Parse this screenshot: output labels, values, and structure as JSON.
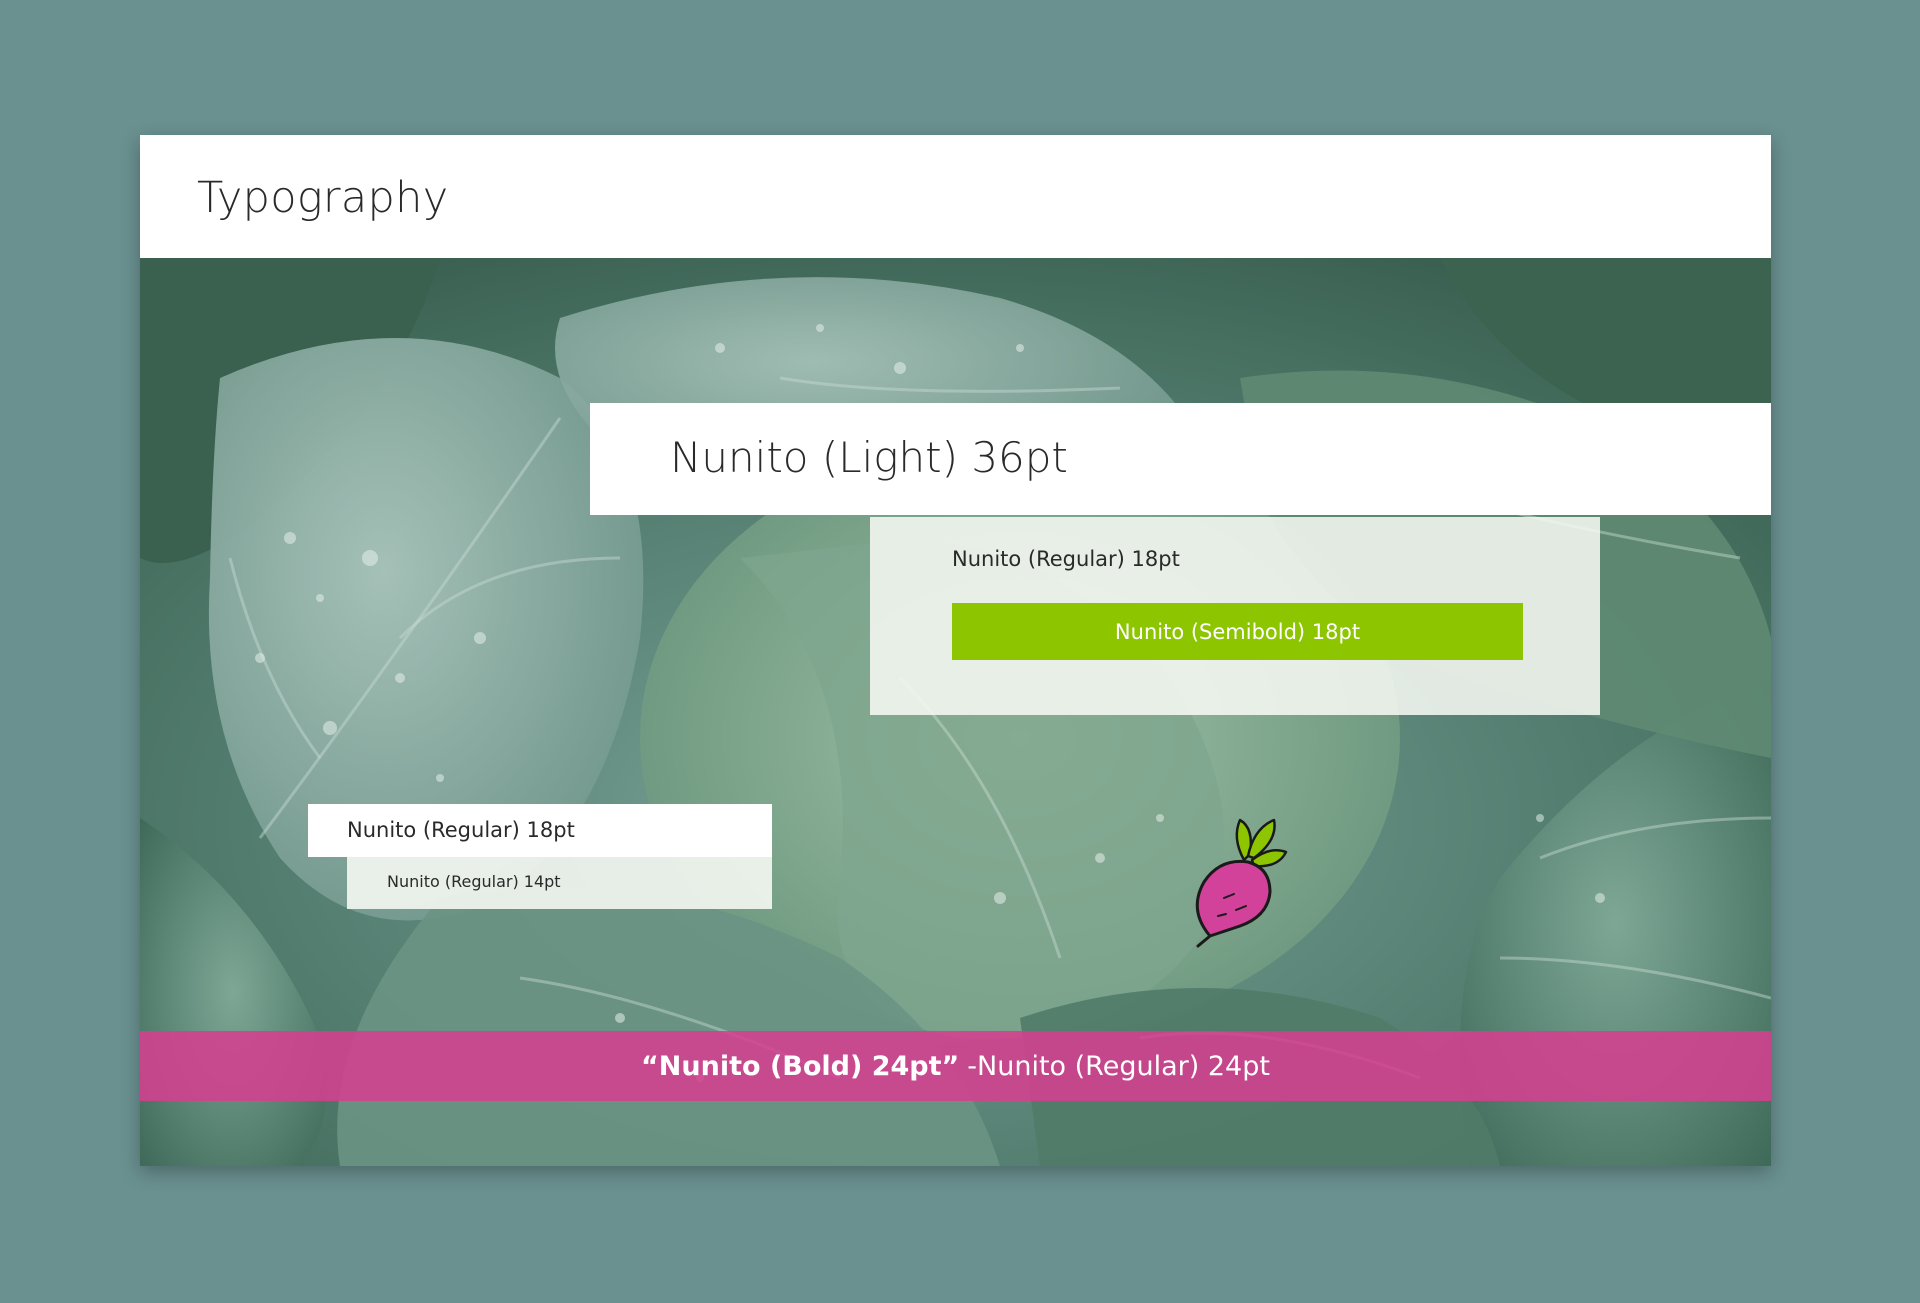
{
  "header": {
    "title": "Typography"
  },
  "samples": {
    "heading": "Nunito (Light) 36pt",
    "body_card_text": "Nunito (Regular) 18pt",
    "button_label": "Nunito (Semibold) 18pt",
    "small_card_text": "Nunito (Regular) 18pt",
    "caption_text": "Nunito (Regular) 14pt"
  },
  "quote": {
    "bold_part": "“Nunito (Bold) 24pt”",
    "regular_part": "-Nunito (Regular) 24pt"
  },
  "colors": {
    "page_background": "#6a9090",
    "button_green": "#8dc600",
    "quote_magenta": "#d5408f",
    "beet_magenta": "#d2429a",
    "leaf_green": "#8dc600"
  },
  "icons": {
    "beet": "beet-icon"
  }
}
